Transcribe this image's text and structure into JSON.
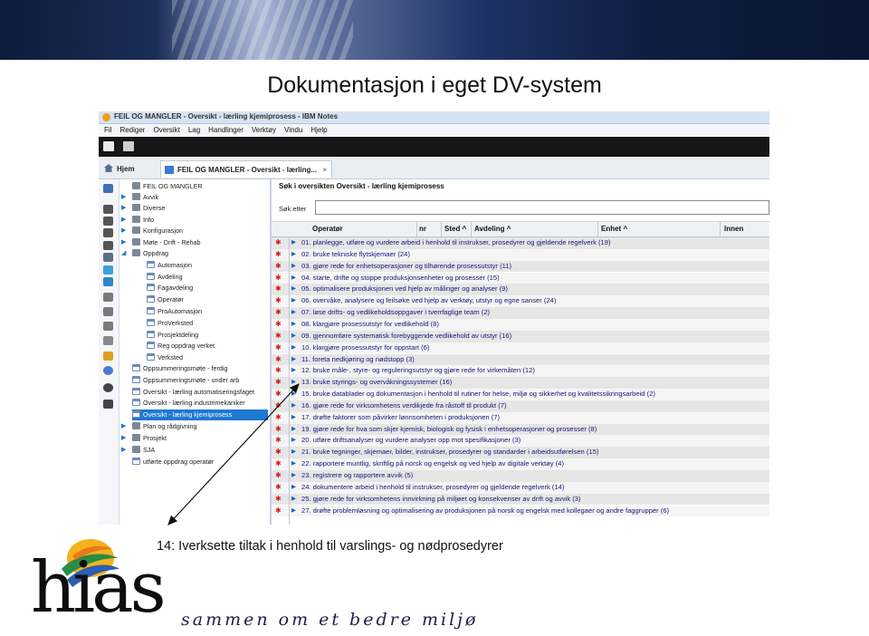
{
  "slide": {
    "title": "Dokumentasjon i eget DV-system",
    "caption": "14: Iverksette tiltak i henhold til varslings- og nødprosedyrer"
  },
  "app": {
    "window_title": "FEIL OG MANGLER - Oversikt - lærling kjemiprosess - IBM Notes",
    "menu": [
      "Fil",
      "Rediger",
      "Oversikt",
      "Lag",
      "Handlinger",
      "Verktøy",
      "Vindu",
      "Hjelp"
    ],
    "tabs": [
      {
        "label": "Hjem"
      },
      {
        "label": "FEIL OG MANGLER - Oversikt - lærling...",
        "close": "×"
      }
    ]
  },
  "nav": {
    "root": "FEIL OG MANGLER",
    "items": [
      {
        "label": "Avvik",
        "level": 1
      },
      {
        "label": "Diverse",
        "level": 1
      },
      {
        "label": "Info",
        "level": 1
      },
      {
        "label": "Konfigurasjon",
        "level": 1
      },
      {
        "label": "Møte - Drift - Rehab",
        "level": 1
      },
      {
        "label": "Oppdrag",
        "level": 1
      },
      {
        "label": "Automasjon",
        "level": 2
      },
      {
        "label": "Avdeling",
        "level": 2
      },
      {
        "label": "Fagavdeling",
        "level": 2
      },
      {
        "label": "Operatør",
        "level": 2
      },
      {
        "label": "ProAutomasjon",
        "level": 2
      },
      {
        "label": "ProVerksted",
        "level": 2
      },
      {
        "label": "Prosjektdeling",
        "level": 2
      },
      {
        "label": "Reg oppdrag verket",
        "level": 2
      },
      {
        "label": "Verksted",
        "level": 2
      },
      {
        "label": "Oppsummeringsmøte - ferdig",
        "level": 1
      },
      {
        "label": "Oppsummeringsmøte - under arb",
        "level": 1
      },
      {
        "label": "Oversikt - lærling automatiseringsfaget",
        "level": 1
      },
      {
        "label": "Oversikt - lærling industrimekaniker",
        "level": 1
      },
      {
        "label": "Oversikt - lærling kjemiprosess",
        "level": 1,
        "selected": true
      },
      {
        "label": "Plan og rådgivning",
        "level": 1
      },
      {
        "label": "Prosjekt",
        "level": 1
      },
      {
        "label": "SJA",
        "level": 1
      },
      {
        "label": "utførte oppdrag operatør",
        "level": 1
      }
    ]
  },
  "search": {
    "title": "Søk i oversikten Oversikt - lærling kjemiprosess",
    "label": "Søk etter",
    "value": ""
  },
  "columns": [
    "Operatør",
    "nr",
    "Sted ^",
    "Avdeling ^",
    "Enhet ^",
    "Innen"
  ],
  "rows": [
    "01. planlegge, utføre og vurdere arbeid i henhold til instrukser, prosedyrer og gjeldende regelverk (19)",
    "02. bruke tekniske flytskjemaer (24)",
    "03. gjøre rede for enhetsoperasjoner og tilhørende prosessutstyr (11)",
    "04. starte, drifte og stoppe produksjonsenheter og prosesser (15)",
    "05. optimalisere produksjonen ved hjelp av målinger og analyser (9)",
    "06. overvåke, analysere og feilsøke ved hjelp av verktøy, utstyr og egne sanser (24)",
    "07. løse drifts- og vedlikeholdsoppgaver i tverrfaglige team (2)",
    "08. klargjøre prosessutstyr for vedlikehold (8)",
    "09. gjennomføre systematisk forebyggende vedlikehold av utstyr (16)",
    "10. klargjøre prosessutstyr for oppstart (6)",
    "11. foreta nedkjøring og nødstopp (3)",
    "12. bruke måle-, styre- og reguleringsutstyr og gjøre rede for virkemåten (12)",
    "13. bruke styrings- og overvåkningssystemer (16)",
    "15. bruke datablader og dokumentasjon i henhold til rutiner for helse, miljø og sikkerhet og kvalitetssikringsarbeid (2)",
    "16. gjøre rede for virksomhetens verdikjede fra råstoff til produkt (7)",
    "17. drøfte faktorer som påvirker lønnsomheten i produksjonen (7)",
    "19. gjøre rede for hva som skjer kjemisk, biologisk og fysisk i enhetsoperasjoner og prosesser (8)",
    "20. utføre driftsanalyser og vurdere analyser opp mot spesifikasjoner (3)",
    "21. bruke tegninger, skjemaer, bilder, instrukser, prosedyrer og standarder i arbeidsutførelsen (15)",
    "22. rapportere muntlig, skriftlig på norsk og engelsk og ved hjelp av digitale verktøy (4)",
    "23. registrere og rapportere avvik (5)",
    "24. dokumentere arbeid i henhold til instrukser, prosedyrer og gjeldende regelverk (14)",
    "25. gjøre rede for virksomhetens innvirkning på miljøet og konsekvenser av drift og avvik (3)",
    "27. drøfte problemløsning og optimalisering av produksjonen på norsk og engelsk med kollegaer og andre faggrupper (6)"
  ],
  "logo": {
    "wordmark": "hias",
    "tagline": "sammen om et bedre miljø"
  },
  "colors": {
    "row_text": "#16157a",
    "star": "#d5181e",
    "selection": "#1f78d1",
    "toolbar": "#161616"
  }
}
